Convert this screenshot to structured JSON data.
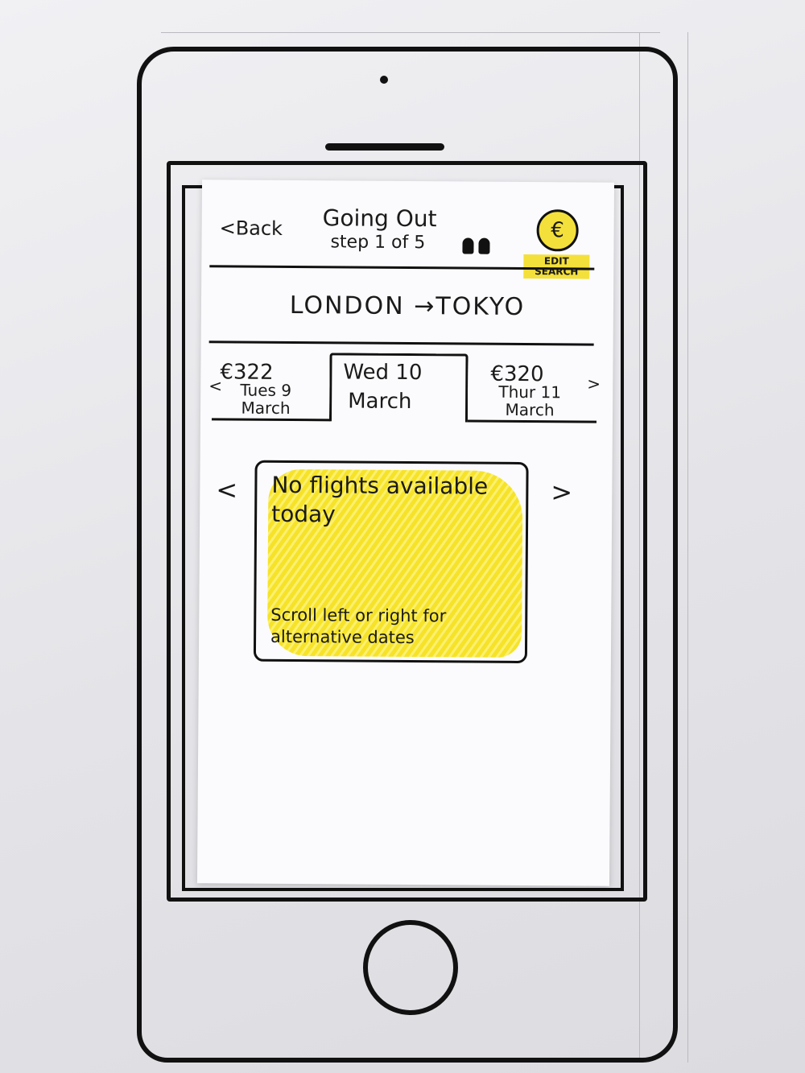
{
  "header": {
    "back_label": "<Back",
    "title": "Going Out",
    "step": "step 1 of 5",
    "currency_symbol": "€",
    "edit_search_label": "EDIT SEARCH"
  },
  "route": {
    "label": "LONDON →TOKYO"
  },
  "date_tabs": {
    "previous": {
      "price": "€322",
      "date": "Tues 9 March",
      "chevron": "<"
    },
    "selected": {
      "date_line1": "Wed 10",
      "date_line2": "March"
    },
    "next": {
      "price": "€320",
      "date": "Thur 11 March",
      "chevron": ">"
    }
  },
  "results": {
    "headline": "No flights available today",
    "hint": "Scroll left or right for alternative dates",
    "prev_chevron": "<",
    "next_chevron": ">"
  },
  "colors": {
    "highlight": "#f4e03b",
    "ink": "#111111",
    "paper": "#fbfbfd"
  },
  "icons": [
    "travellers-icon",
    "euro-icon",
    "chevron-left-icon",
    "chevron-right-icon"
  ]
}
